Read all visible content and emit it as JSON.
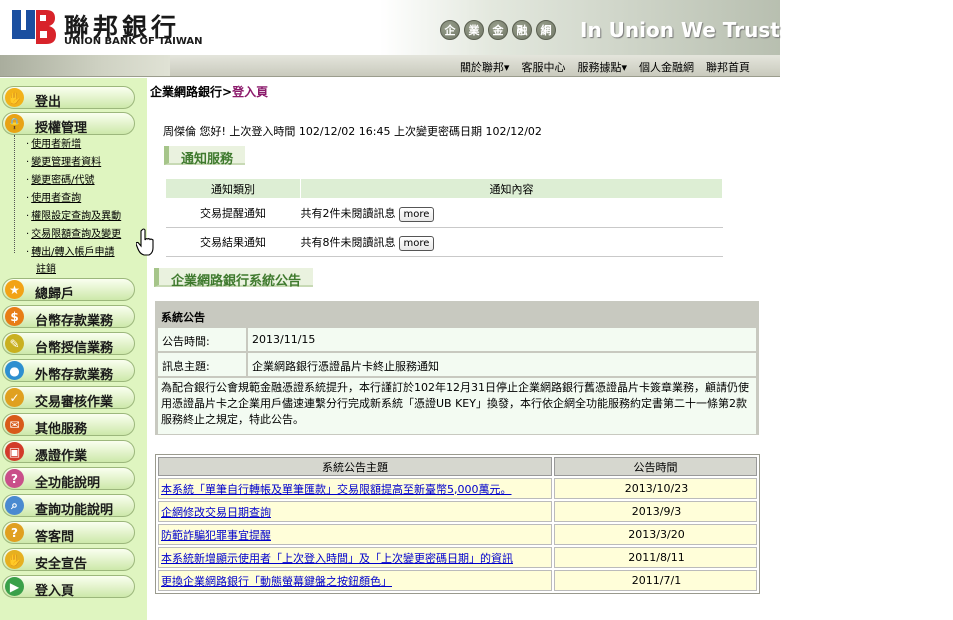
{
  "header": {
    "logo_cn": "聯邦銀行",
    "logo_en": "UNION BANK OF TAIWAN",
    "pills": [
      "企",
      "業",
      "金",
      "融",
      "網"
    ],
    "slogan": "In Union We Trust"
  },
  "nav": [
    "關於聯邦▾",
    "客服中心",
    "服務據點▾",
    "個人金融網",
    "聯邦首頁"
  ],
  "sidebar": {
    "items": [
      {
        "label": "登出",
        "icon": "logout-icon",
        "color": "#f2b21a",
        "glyph": "✋"
      },
      {
        "label": "授權管理",
        "icon": "authorization-icon",
        "color": "#e8a316",
        "glyph": "🔒"
      },
      {
        "label": "總歸戶",
        "icon": "accounts-icon",
        "color": "#f2a316",
        "glyph": "★"
      },
      {
        "label": "台幣存款業務",
        "icon": "twd-deposit-icon",
        "color": "#e87d16",
        "glyph": "$"
      },
      {
        "label": "台幣授信業務",
        "icon": "twd-credit-icon",
        "color": "#c9b020",
        "glyph": "✎"
      },
      {
        "label": "外幣存款業務",
        "icon": "fx-deposit-icon",
        "color": "#2e8fd0",
        "glyph": "●"
      },
      {
        "label": "交易審核作業",
        "icon": "review-icon",
        "color": "#e0a020",
        "glyph": "✓"
      },
      {
        "label": "其他服務",
        "icon": "other-service-icon",
        "color": "#d85a1a",
        "glyph": "✉"
      },
      {
        "label": "憑證作業",
        "icon": "certificate-icon",
        "color": "#d23a2a",
        "glyph": "▣"
      },
      {
        "label": "全功能說明",
        "icon": "full-guide-icon",
        "color": "#c94f8a",
        "glyph": "?"
      },
      {
        "label": "查詢功能說明",
        "icon": "query-guide-icon",
        "color": "#4a8ad0",
        "glyph": "⌕"
      },
      {
        "label": "答客問",
        "icon": "faq-icon",
        "color": "#e0a020",
        "glyph": "?"
      },
      {
        "label": "安全宣告",
        "icon": "security-icon",
        "color": "#e6b020",
        "glyph": "✋"
      },
      {
        "label": "登入頁",
        "icon": "login-page-icon",
        "color": "#3aa04a",
        "glyph": "▶"
      }
    ],
    "sub_items": [
      "使用者新增",
      "變更管理者資料",
      "變更密碼/代號",
      "使用者查詢",
      "權限設定查詢及異動",
      "交易限額查詢及變更",
      "轉出/轉入帳戶申請",
      "註銷"
    ]
  },
  "main": {
    "crumb_prefix": "企業網路銀行>",
    "crumb_current": "登入頁",
    "greeting": "周傑倫 您好!  上次登入時間 102/12/02 16:45 上次變更密碼日期 102/12/02",
    "notice_section": "通知服務",
    "notice_headers": [
      "通知類別",
      "通知內容"
    ],
    "notices": [
      {
        "type": "交易提醒通知",
        "content": "共有2件未閱讀訊息",
        "button": "more"
      },
      {
        "type": "交易結果通知",
        "content": "共有8件未閱讀訊息",
        "button": "more"
      }
    ],
    "announce_section": "企業網路銀行系統公告",
    "announcement": {
      "title": "系統公告",
      "time_label": "公告時間:",
      "time_value": "2013/11/15",
      "subject_label": "訊息主題:",
      "subject_value": "企業網路銀行憑證晶片卡終止服務通知",
      "body": "為配合銀行公會規範金融憑證系統提升，本行謹訂於102年12月31日停止企業網路銀行舊憑證晶片卡簽章業務，顧請仍使用憑證晶片卡之企業用戶儘速連繫分行完成新系統「憑證UB KEY」換發，本行依企網全功能服務約定書第二十一條第2款服務終止之規定，特此公告。"
    },
    "list_headers": [
      "系統公告主題",
      "公告時間"
    ],
    "list": [
      {
        "title": "本系統「單筆自行轉帳及單筆匯款」交易限額提高至新臺幣5,000萬元。",
        "date": "2013/10/23"
      },
      {
        "title": "企網修改交易日期查詢",
        "date": "2013/9/3"
      },
      {
        "title": "防範詐騙犯罪事宜提醒",
        "date": "2013/3/20"
      },
      {
        "title": "本系統新增顯示使用者「上次登入時間」及「上次變更密碼日期」的資訊",
        "date": "2011/8/11"
      },
      {
        "title": "更換企業網路銀行「動態螢幕鍵盤之按鈕顏色」",
        "date": "2011/7/1"
      }
    ]
  }
}
